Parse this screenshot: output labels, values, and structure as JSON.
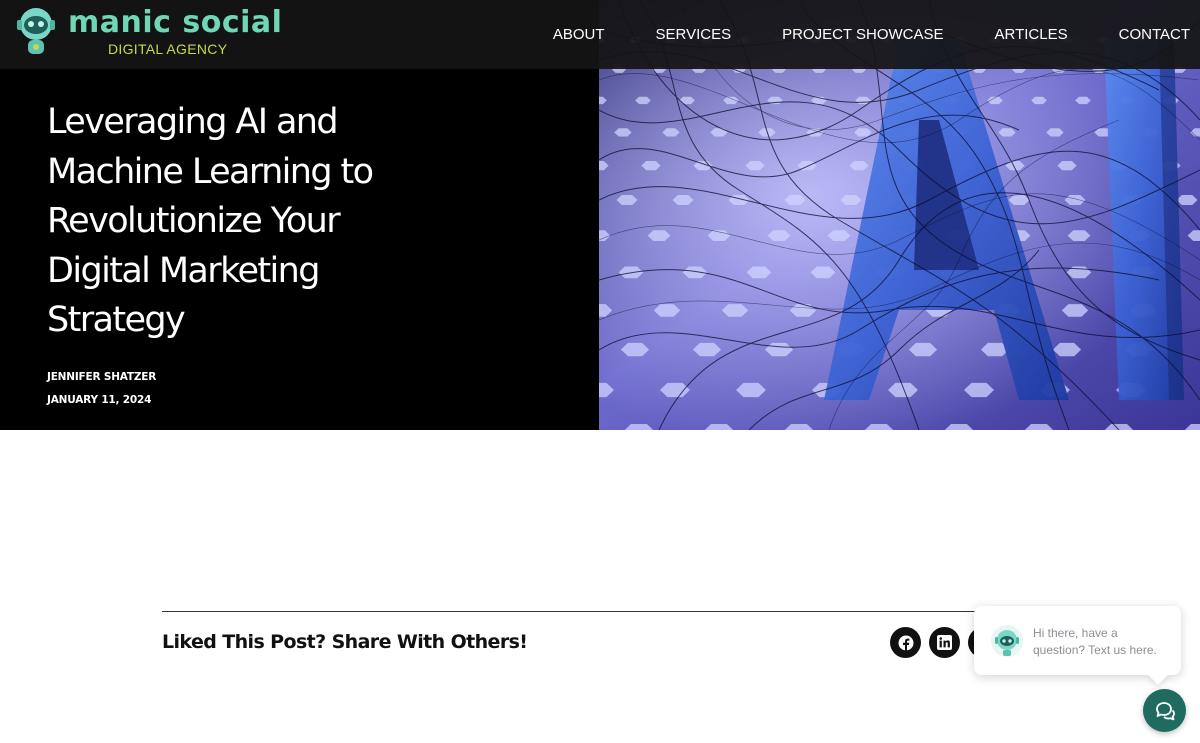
{
  "brand": {
    "name": "manic social",
    "tagline": "DIGITAL AGENCY",
    "colors": {
      "wordmark": "#6fd6b6",
      "tagline": "#c3d94e"
    }
  },
  "nav": {
    "items": [
      {
        "label": "ABOUT"
      },
      {
        "label": "SERVICES"
      },
      {
        "label": "PROJECT SHOWCASE"
      },
      {
        "label": "ARTICLES"
      },
      {
        "label": "CONTACT"
      }
    ]
  },
  "hero": {
    "title": "Leveraging AI and Machine Learning to Revolutionize Your Digital Marketing Strategy",
    "author": "JENNIFER SHATZER",
    "date": "JANUARY 11, 2024",
    "image_text": "AI",
    "image_icon": "ai-letters-neural-network-image"
  },
  "share": {
    "heading": "Liked This Post? Share With Others!",
    "buttons": [
      {
        "icon": "facebook-icon"
      },
      {
        "icon": "linkedin-icon"
      },
      {
        "icon": "share-icon"
      }
    ]
  },
  "chat": {
    "message": "Hi there, have a question? Text us here.",
    "launcher_icon": "chat-bubbles-icon",
    "accent": "#1f6b60"
  }
}
